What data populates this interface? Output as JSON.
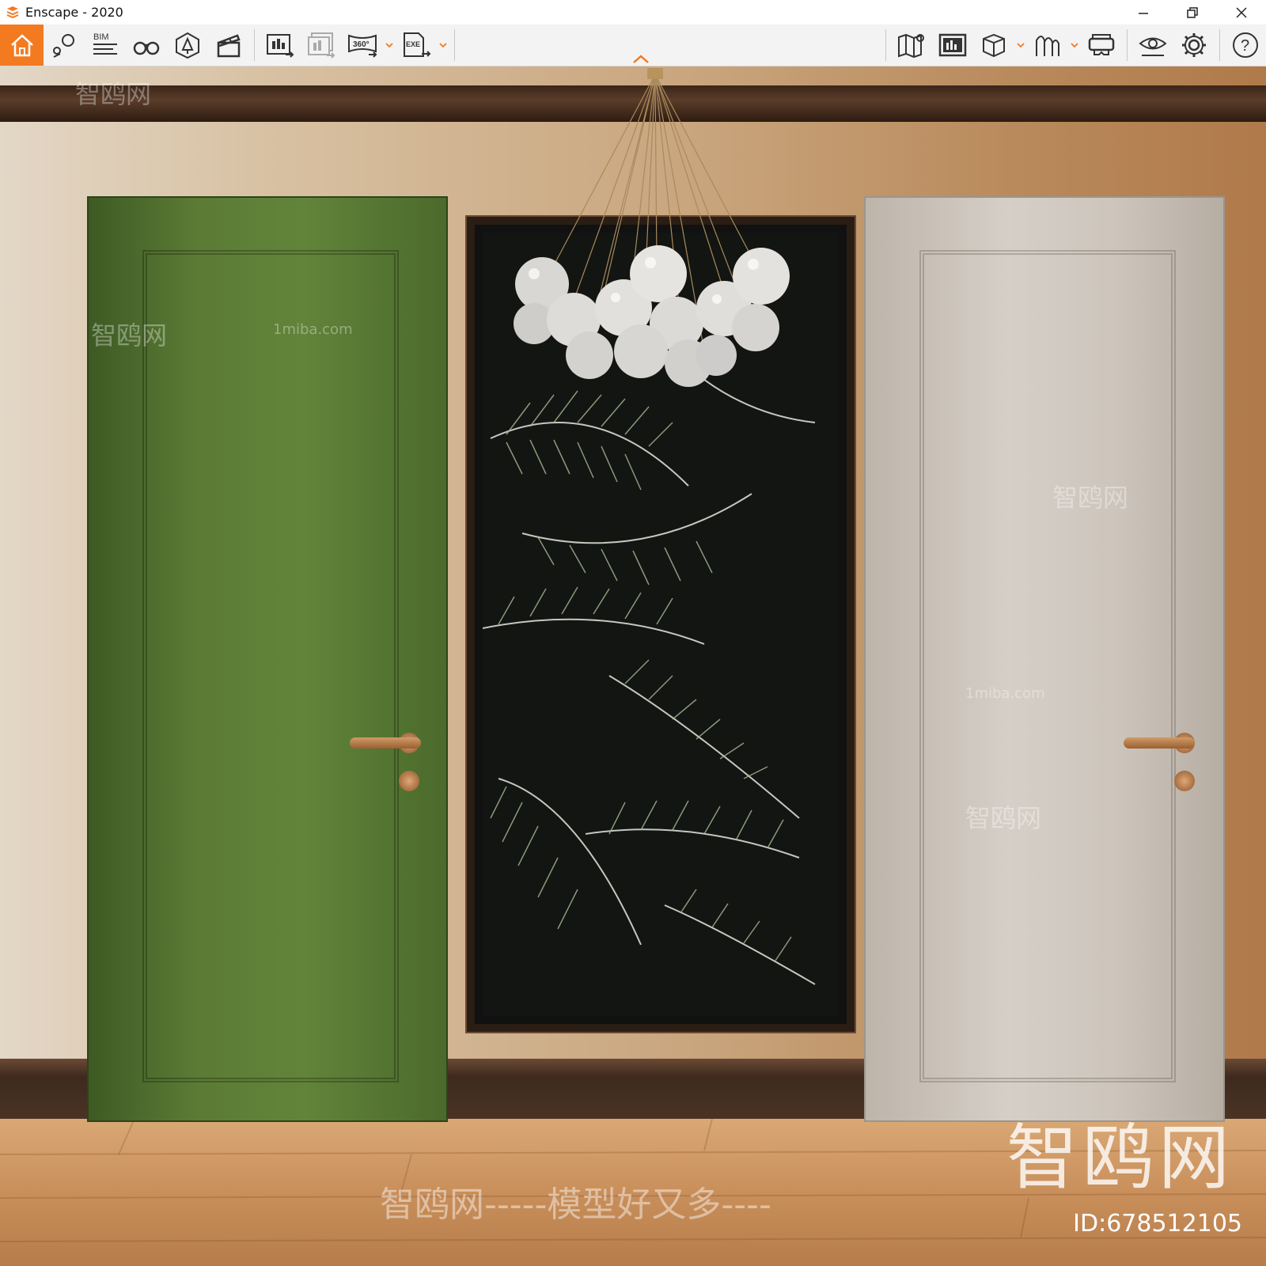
{
  "window": {
    "title": "Enscape - 2020",
    "controls": {
      "minimize": "—",
      "restore": "❐",
      "close": "✕"
    }
  },
  "toolbar": {
    "accent": "#f47a20",
    "left_buttons": [
      {
        "name": "home-icon",
        "label": ""
      },
      {
        "name": "view-management-icon",
        "label": ""
      },
      {
        "name": "bim-icon",
        "label": "BIM"
      },
      {
        "name": "binoculars-icon",
        "label": ""
      },
      {
        "name": "asset-library-icon",
        "label": ""
      },
      {
        "name": "video-editor-icon",
        "label": ""
      },
      {
        "name": "render-screenshot-icon",
        "label": ""
      },
      {
        "name": "batch-render-icon",
        "label": ""
      },
      {
        "name": "panorama-360-icon",
        "label": "360°"
      },
      {
        "name": "export-exe-icon",
        "label": "EXE"
      }
    ],
    "right_buttons": [
      {
        "name": "minimap-icon",
        "label": ""
      },
      {
        "name": "render-view-icon",
        "label": ""
      },
      {
        "name": "cube-icon",
        "label": ""
      },
      {
        "name": "atmosphere-icon",
        "label": ""
      },
      {
        "name": "vr-headset-icon",
        "label": ""
      },
      {
        "name": "visual-settings-icon",
        "label": ""
      },
      {
        "name": "settings-icon",
        "label": ""
      },
      {
        "name": "help-icon",
        "label": "?"
      }
    ]
  },
  "scene": {
    "watermark_large": "智鸥网",
    "watermark_id": "ID:678512105",
    "watermark_center": "智鸥网-----模型好又多----",
    "watermark_small": "1miba.com",
    "colors": {
      "green_door": "#5b7b35",
      "grey_door": "#d0c8bf",
      "frame": "#2a1d14"
    }
  }
}
